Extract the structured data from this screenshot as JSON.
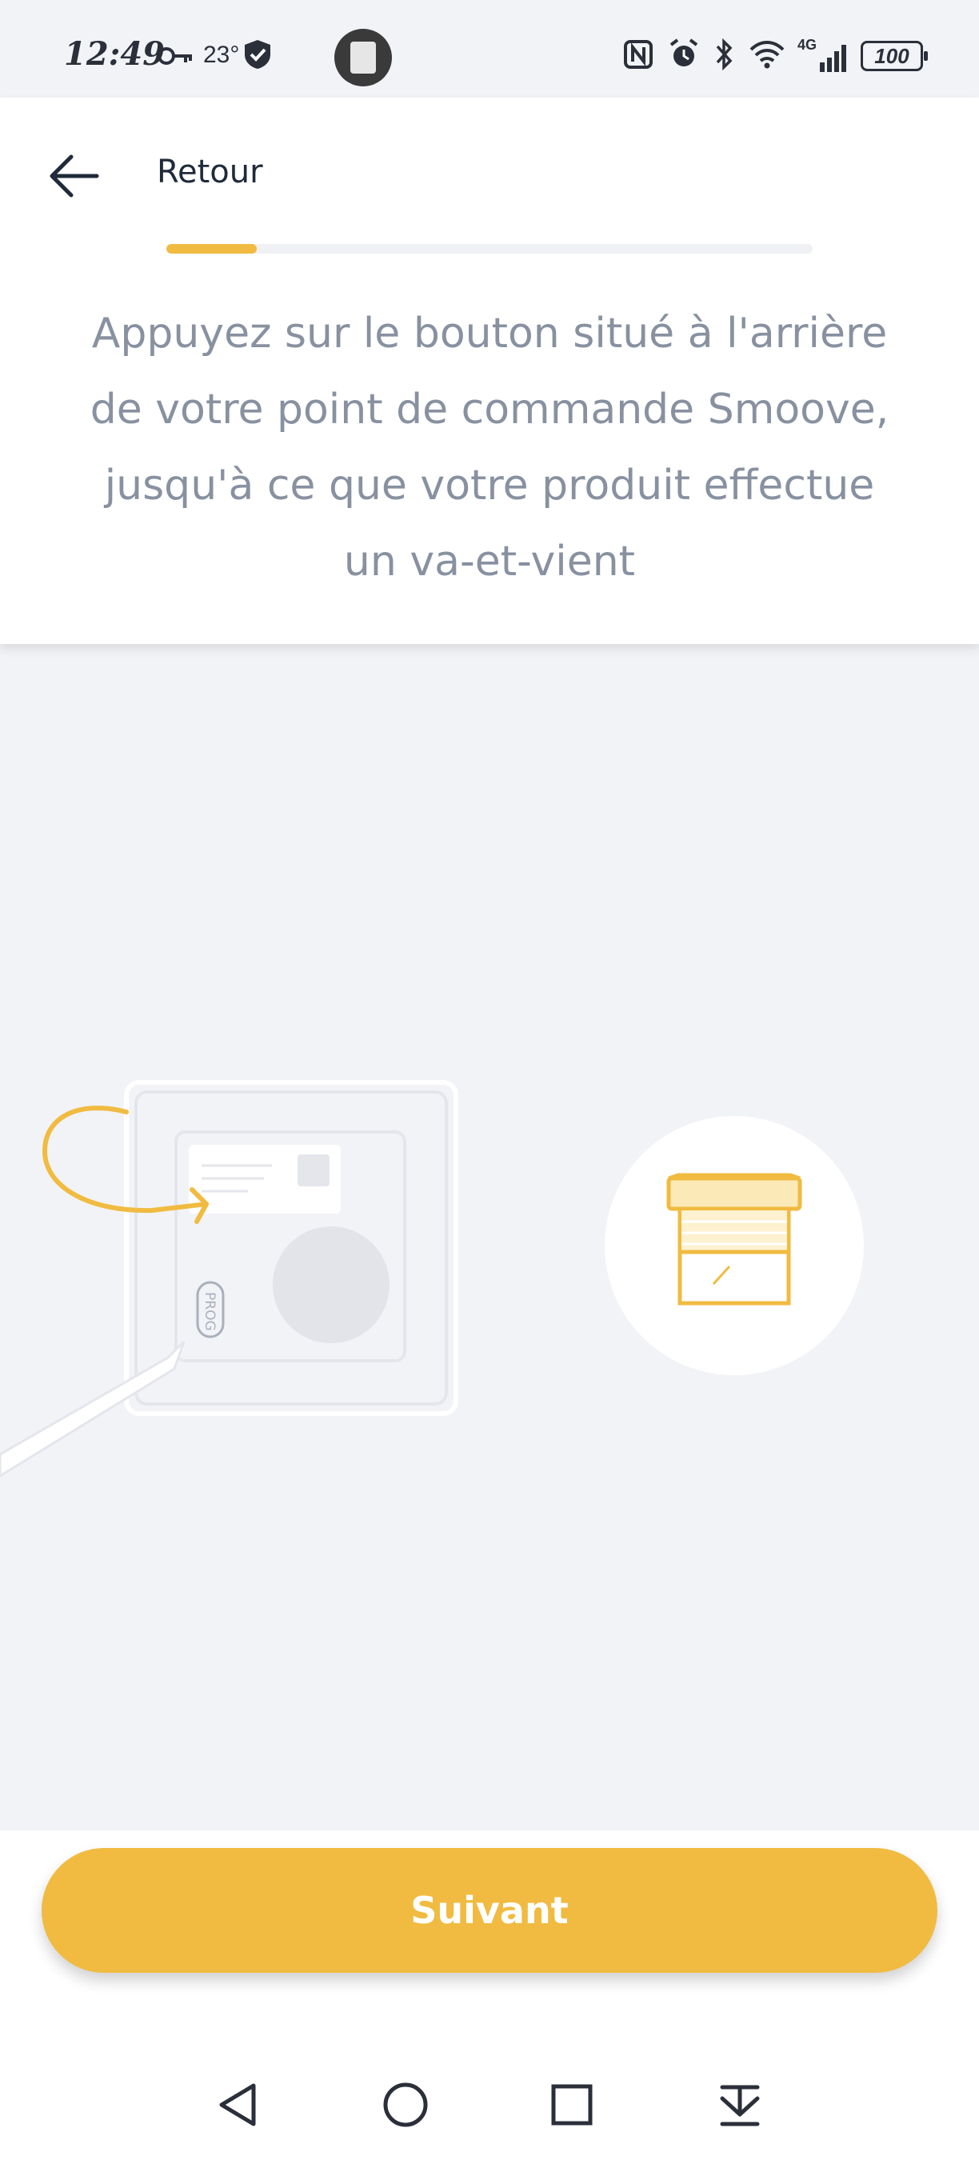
{
  "status_bar": {
    "time": "12:49",
    "temperature": "23°",
    "battery": "100",
    "network": "4G",
    "icons": [
      "key-icon",
      "shield-check-icon",
      "nfc-icon",
      "alarm-icon",
      "bluetooth-icon",
      "wifi-icon",
      "signal-icon",
      "battery-icon"
    ]
  },
  "header": {
    "back_label": "Retour",
    "progress_fraction": 0.14,
    "instruction": "Appuyez sur le bouton situé à l'arrière de votre point de commande Smoove, jusqu'à ce que votre produit effectue un va-et-vient"
  },
  "illustration": {
    "prog_label": "PROG",
    "accent_color": "#f0bb40"
  },
  "footer": {
    "next_label": "Suivant"
  },
  "navbar": {
    "icons": [
      "back-triangle-icon",
      "home-circle-icon",
      "recents-square-icon",
      "notification-pull-icon"
    ]
  },
  "colors": {
    "accent": "#f0bb40",
    "background": "#f2f3f7",
    "text_muted": "#8891a0",
    "text_dark": "#1f2a3a"
  }
}
